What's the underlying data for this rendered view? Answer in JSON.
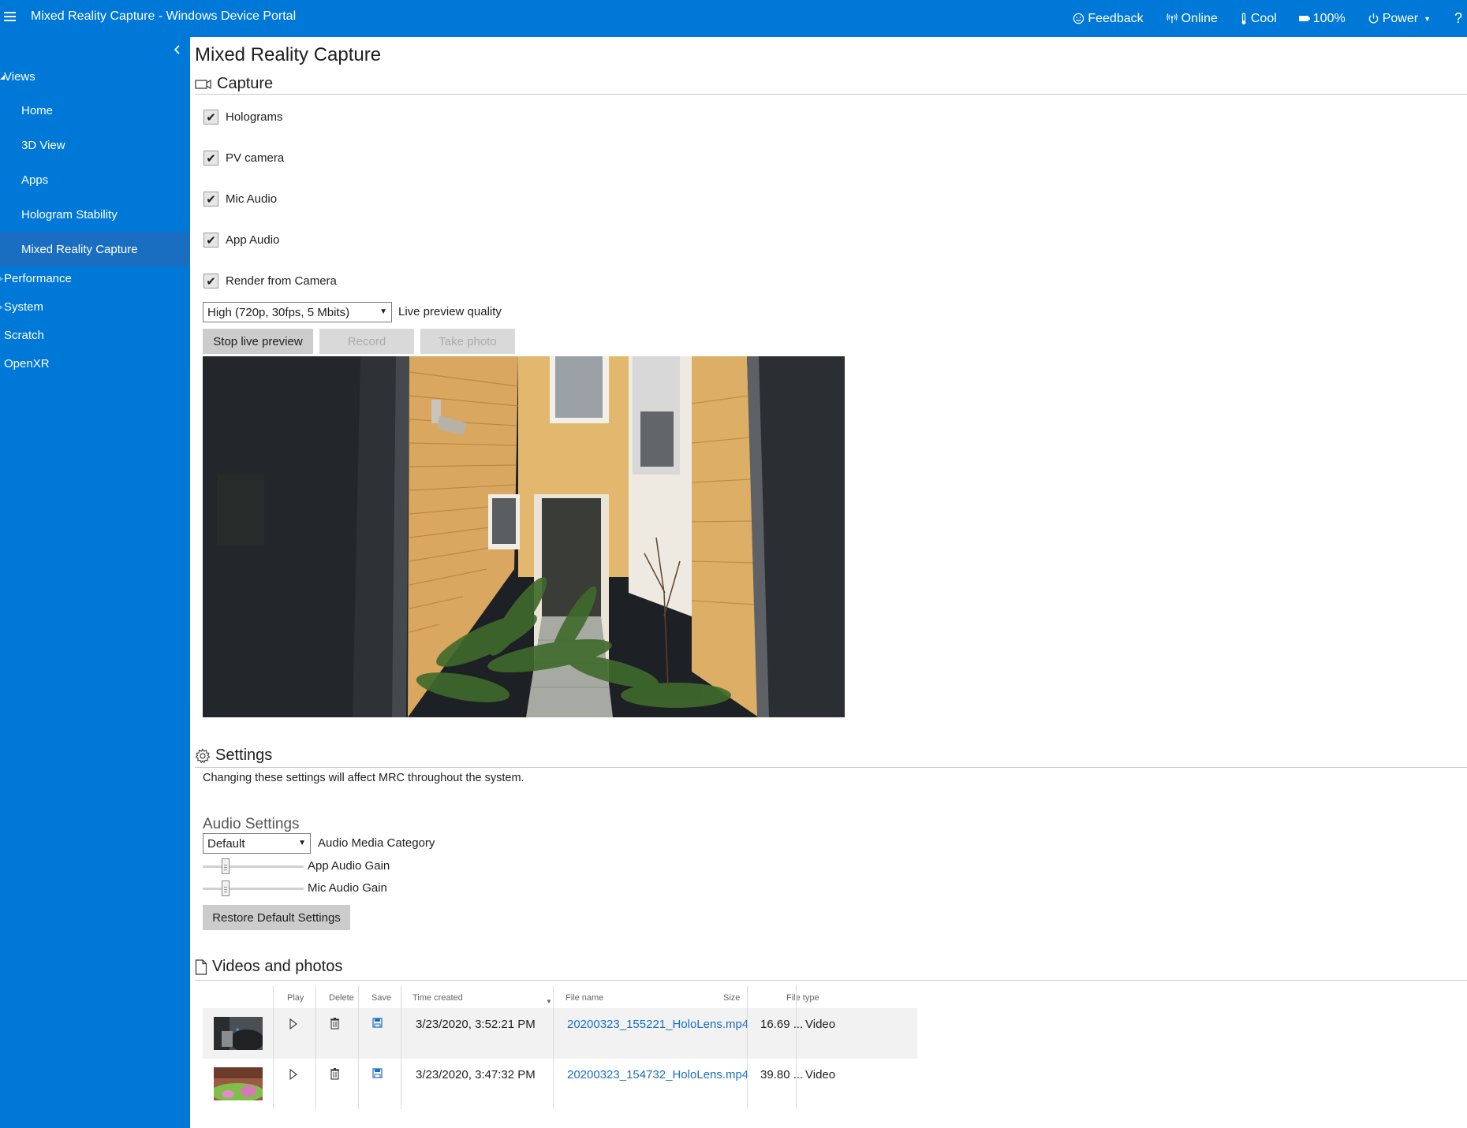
{
  "app": {
    "title": "Mixed Reality Capture - Windows Device Portal"
  },
  "topnav": {
    "feedback": "Feedback",
    "online": "Online",
    "cool": "Cool",
    "battery": "100%",
    "power": "Power",
    "help": "?"
  },
  "sidebar": {
    "views_label": "Views",
    "views_items": [
      "Home",
      "3D View",
      "Apps",
      "Hologram Stability",
      "Mixed Reality Capture"
    ],
    "groups": [
      "Performance",
      "System",
      "Scratch",
      "OpenXR"
    ]
  },
  "page": {
    "title": "Mixed Reality Capture"
  },
  "capture": {
    "heading": "Capture",
    "options": [
      {
        "label": "Holograms",
        "checked": true
      },
      {
        "label": "PV camera",
        "checked": true
      },
      {
        "label": "Mic Audio",
        "checked": true
      },
      {
        "label": "App Audio",
        "checked": true
      },
      {
        "label": "Render from Camera",
        "checked": true
      }
    ],
    "quality_value": "High (720p, 30fps, 5 Mbits)",
    "quality_label": "Live preview quality",
    "buttons": {
      "stop_preview": "Stop live preview",
      "record": "Record",
      "take_photo": "Take photo"
    }
  },
  "settings": {
    "heading": "Settings",
    "description": "Changing these settings will affect MRC throughout the system.",
    "audio_heading": "Audio Settings",
    "media_category_value": "Default",
    "media_category_label": "Audio Media Category",
    "app_audio_gain_label": "App Audio Gain",
    "mic_audio_gain_label": "Mic Audio Gain",
    "restore_button": "Restore Default Settings"
  },
  "files": {
    "heading": "Videos and photos",
    "columns": {
      "play": "Play",
      "delete": "Delete",
      "save": "Save",
      "time": "Time created",
      "name": "File name",
      "size": "Size",
      "type": "File type"
    },
    "rows": [
      {
        "time": "3/23/2020, 3:52:21 PM",
        "name": "20200323_155221_HoloLens.mp4",
        "size": "16.69 ...",
        "type": "Video"
      },
      {
        "time": "3/23/2020, 3:47:32 PM",
        "name": "20200323_154732_HoloLens.mp4",
        "size": "39.80 ...",
        "type": "Video"
      }
    ]
  },
  "colors": {
    "accent": "#0078d7",
    "link": "#1a6ec2",
    "button": "#cccccc"
  }
}
